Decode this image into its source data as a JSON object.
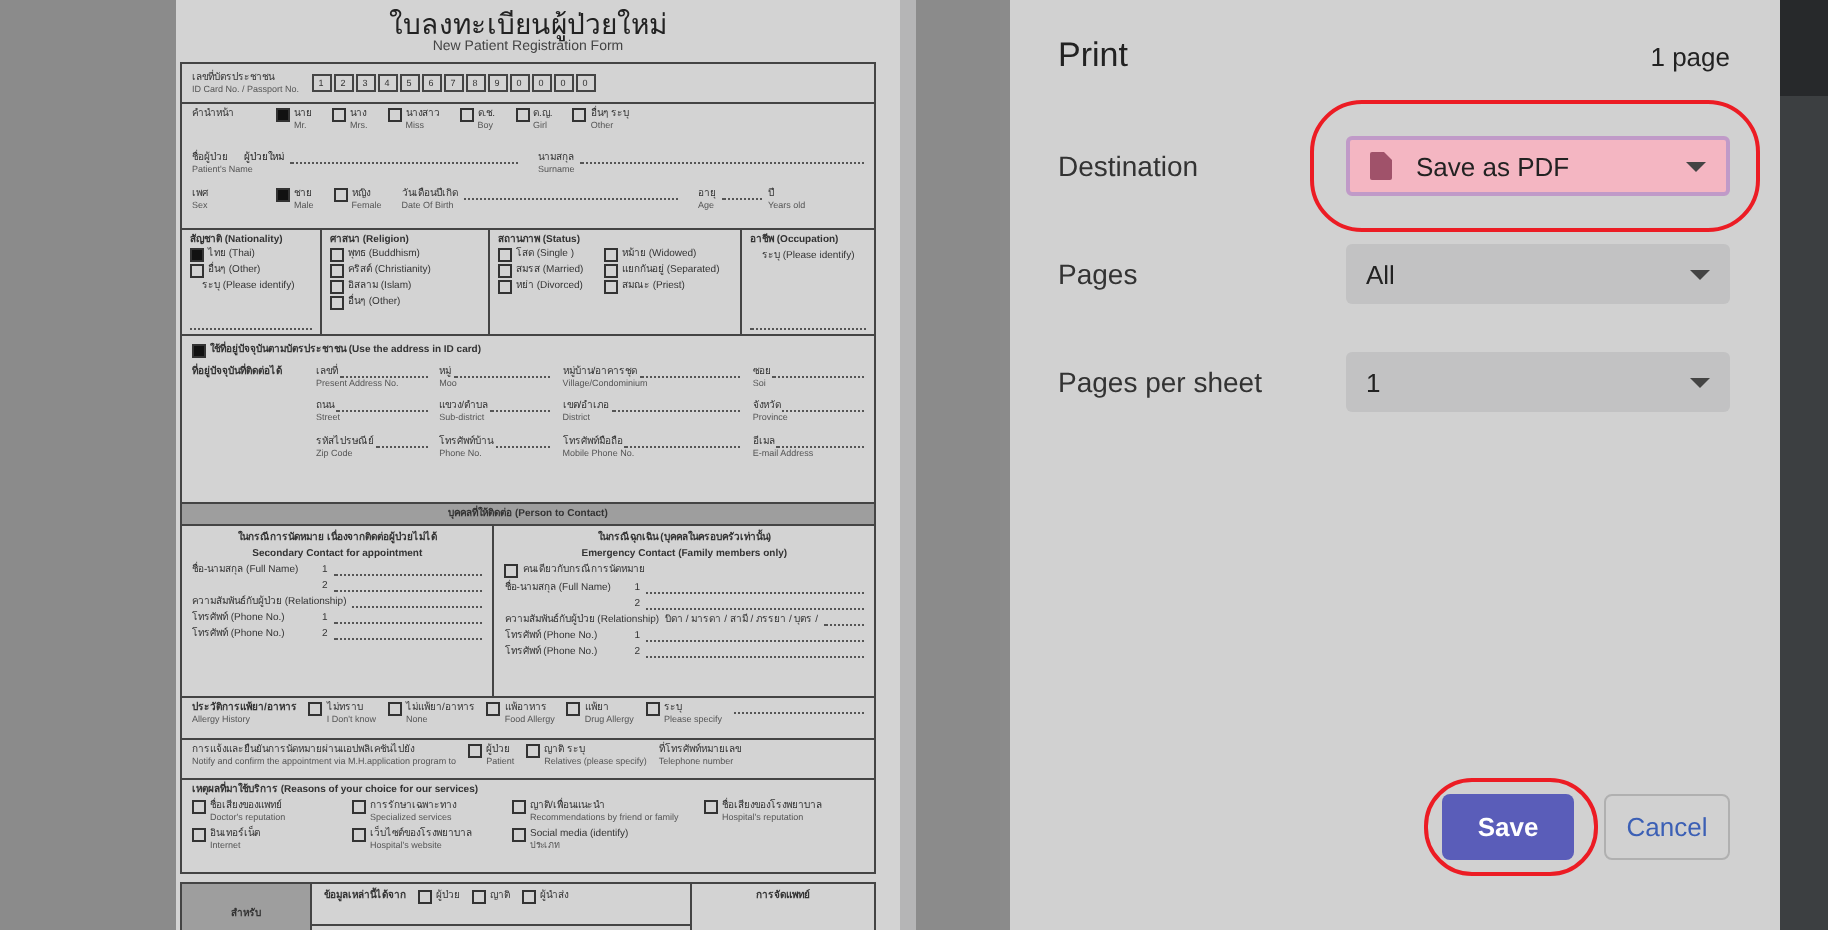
{
  "form": {
    "title_th": "ใบลงทะเบียนผู้ป่วยใหม่",
    "title_en": "New Patient Registration Form",
    "id_card": {
      "th": "เลขที่บัตรประชาชน",
      "en": "ID Card No. / Passport  No.",
      "digits": [
        "1",
        "2",
        "3",
        "4",
        "5",
        "6",
        "7",
        "8",
        "9",
        "0",
        "0",
        "0",
        "0"
      ]
    },
    "prefix": {
      "th": "คำนำหน้า",
      "options": [
        {
          "th": "นาย",
          "en": "Mr.",
          "checked": true
        },
        {
          "th": "นาง",
          "en": "Mrs.",
          "checked": false
        },
        {
          "th": "นางสาว",
          "en": "Miss",
          "checked": false
        },
        {
          "th": "ด.ช.",
          "en": "Boy",
          "checked": false
        },
        {
          "th": "ด.ญ.",
          "en": "Girl",
          "checked": false
        },
        {
          "th": "อื่นๆ ระบุ",
          "en": "Other",
          "checked": false
        }
      ]
    },
    "name_fields": [
      {
        "th": "ชื่อผู้ป่วย",
        "value": "ผู้ป่วยใหม่",
        "en": "Patient's Name"
      },
      {
        "th": "นามสกุล",
        "en": "Surname"
      }
    ],
    "sex": {
      "th": "เพศ",
      "en": "Sex",
      "options": [
        {
          "th": "ชาย",
          "en": "Male",
          "checked": true
        },
        {
          "th": "หญิง",
          "en": "Female",
          "checked": false
        }
      ]
    },
    "birth": {
      "th": "วันเดือนปีเกิด",
      "en": "Date Of  Birth"
    },
    "age": {
      "th": "อายุ",
      "en": "Age",
      "unit_th": "ปี",
      "unit_en": "Years old"
    },
    "columns": [
      {
        "heading": "สัญชาติ (Nationality)",
        "options": [
          {
            "label": "ไทย (Thai)",
            "checked": true
          },
          {
            "label": "อื่นๆ (Other)",
            "checked": false
          }
        ],
        "note": "ระบุ (Please identify)"
      },
      {
        "heading": "ศาสนา (Religion)",
        "options": [
          {
            "label": "พุทธ (Buddhism)",
            "checked": false
          },
          {
            "label": "คริสต์ (Christianity)",
            "checked": false
          },
          {
            "label": "อิสลาม (Islam)",
            "checked": false
          },
          {
            "label": "อื่นๆ (Other)",
            "checked": false
          }
        ]
      },
      {
        "heading": "สถานภาพ (Status)",
        "options": [
          {
            "label": "โสด (Single )",
            "checked": false
          },
          {
            "label": "หม้าย (Widowed)",
            "checked": false
          },
          {
            "label": "สมรส (Married)",
            "checked": false
          },
          {
            "label": "แยกกันอยู่ (Separated)",
            "checked": false
          },
          {
            "label": "หย่า (Divorced)",
            "checked": false
          },
          {
            "label": "สมณะ (Priest)",
            "checked": false
          }
        ]
      },
      {
        "heading": "อาชีพ (Occupation)",
        "note": "ระบุ (Please identify)"
      }
    ],
    "address": {
      "use_id": {
        "label": "ใช้ที่อยู่ปัจจุบันตามบัตรประชาชน (Use the address in ID card)",
        "checked": true
      },
      "heading": "ที่อยู่ปัจจุบันที่ติดต่อได้",
      "fields": [
        {
          "th": "เลขที่",
          "en": "Present Address No."
        },
        {
          "th": "หมู่",
          "en": "Moo"
        },
        {
          "th": "หมู่บ้าน/อาคารชุด",
          "en": "Village/Condominium"
        },
        {
          "th": "ซอย",
          "en": "Soi"
        },
        {
          "th": "ถนน",
          "en": "Street"
        },
        {
          "th": "แขวง/ตำบล",
          "en": "Sub-district"
        },
        {
          "th": "เขต/อำเภอ",
          "en": "District"
        },
        {
          "th": "จังหวัด",
          "en": "Province"
        },
        {
          "th": "รหัสไปรษณีย์",
          "en": "Zip Code"
        },
        {
          "th": "โทรศัพท์บ้าน",
          "en": "Phone No."
        },
        {
          "th": "โทรศัพท์มือถือ",
          "en": "Mobile Phone No."
        },
        {
          "th": "อีเมล",
          "en": "E-mail Address"
        }
      ]
    },
    "contact_banner": "บุคคลที่ให้ติดต่อ (Person to Contact)",
    "contacts": [
      {
        "heading_th": "ในกรณีการนัดหมาย เนื่องจากติดต่อผู้ป่วยไม่ได้",
        "heading_en": "Secondary Contact for appointment",
        "lines": [
          {
            "label": "ชื่อ-นามสกุล (Full Name)",
            "num": "1"
          },
          {
            "num": "2"
          },
          {
            "label": "ความสัมพันธ์กับผู้ป่วย (Relationship)"
          },
          {
            "label": "โทรศัพท์ (Phone No.)",
            "num": "1"
          },
          {
            "label": "โทรศัพท์ (Phone No.)",
            "num": "2"
          }
        ]
      },
      {
        "heading_th": "ในกรณีฉุกเฉิน (บุคคลในครอบครัวเท่านั้น)",
        "heading_en": "Emergency Contact (Family members only)",
        "same": {
          "label": "คนเดียวกับกรณีการนัดหมาย",
          "checked": false
        },
        "lines": [
          {
            "label": "ชื่อ-นามสกุล (Full Name)",
            "num": "1"
          },
          {
            "num": "2"
          },
          {
            "label": "ความสัมพันธ์กับผู้ป่วย (Relationship)",
            "num": "บิดา / มารดา / สามี / ภรรยา / บุตร /"
          },
          {
            "label": "โทรศัพท์ (Phone No.)",
            "num": "1"
          },
          {
            "label": "โทรศัพท์ (Phone No.)",
            "num": "2"
          }
        ]
      }
    ],
    "allergy": {
      "th": "ประวัติการแพ้ยา/อาหาร",
      "en": "Allergy History",
      "options": [
        {
          "th": "ไม่ทราบ",
          "en": "I Don't  know",
          "checked": false
        },
        {
          "th": "ไม่แพ้ยา/อาหาร",
          "en": "None",
          "checked": false
        },
        {
          "th": "แพ้อาหาร",
          "en": "Food Allergy",
          "checked": false
        },
        {
          "th": "แพ้ยา",
          "en": "Drug Allergy",
          "checked": false
        },
        {
          "th": "ระบุ",
          "en": "Please specify",
          "checked": false
        }
      ]
    },
    "notify": {
      "th": "การแจ้งและยืนยันการนัดหมายผ่านแอปพลิเคชันไปยัง",
      "en": "Notify and confirm the appointment via M.H.application program to",
      "options": [
        {
          "th": "ผู้ป่วย",
          "en": "Patient",
          "checked": false
        },
        {
          "th": "ญาติ ระบุ",
          "en": "Relatives (please specify)",
          "checked": false
        }
      ],
      "phone_th": "ที่โทรศัพท์หมายเลข",
      "phone_en": "Telephone number"
    },
    "reasons": {
      "heading": "เหตุผลที่มาใช้บริการ (Reasons of your choice for our services)",
      "options": [
        {
          "th": "ชื่อเสียงของแพทย์",
          "en": "Doctor's reputation",
          "checked": false
        },
        {
          "th": "การรักษาเฉพาะทาง",
          "en": "Specialized services",
          "checked": false
        },
        {
          "th": "ญาติ/เพื่อนแนะนำ",
          "en": "Recommendations by friend or family",
          "checked": false
        },
        {
          "th": "ชื่อเสียงของโรงพยาบาล",
          "en": "Hospital's reputation",
          "checked": false
        },
        {
          "th": "อินเทอร์เน็ต",
          "en": "Internet",
          "checked": false
        },
        {
          "th": "เว็บไซต์ของโรงพยาบาล",
          "en": "Hospital's website",
          "checked": false
        },
        {
          "th": "Social media (identify)",
          "en": "ประเภท",
          "checked": false
        }
      ]
    },
    "source": {
      "side": "สำหรับ",
      "th": "ข้อมูลเหล่านี้ได้จาก",
      "options": [
        {
          "th": "ผู้ป่วย",
          "checked": false
        },
        {
          "th": "ญาติ",
          "checked": false
        },
        {
          "th": "ผู้นำส่ง",
          "checked": false
        }
      ],
      "doctor": "การจัดแพทย์"
    }
  },
  "print": {
    "title": "Print",
    "page_count": "1 page",
    "settings": [
      {
        "label": "Destination",
        "value": "Save as PDF",
        "kind": "destination",
        "highlighted": true
      },
      {
        "label": "Pages",
        "value": "All",
        "kind": "plain",
        "highlighted": false
      },
      {
        "label": "Pages per sheet",
        "value": "1",
        "kind": "plain",
        "highlighted": false
      }
    ],
    "buttons": [
      {
        "label": "Save",
        "kind": "primary",
        "highlighted": true
      },
      {
        "label": "Cancel",
        "kind": "secondary",
        "highlighted": false
      }
    ]
  }
}
